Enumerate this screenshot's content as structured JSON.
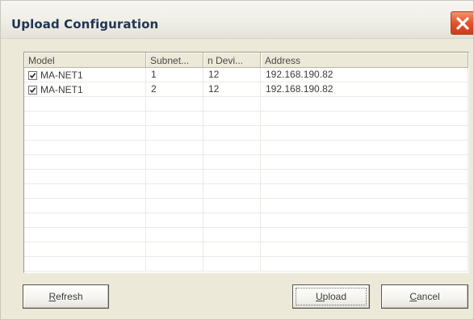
{
  "dialog": {
    "title": "Upload Configuration",
    "close_icon": "close-x-icon"
  },
  "list": {
    "columns": [
      "Model",
      "Subnet...",
      "n Devi...",
      "Address"
    ],
    "rows": [
      {
        "checked": true,
        "model": "MA-NET1",
        "subnet": "1",
        "devices": "12",
        "address": "192.168.190.82"
      },
      {
        "checked": true,
        "model": "MA-NET1",
        "subnet": "2",
        "devices": "12",
        "address": "192.168.190.82"
      }
    ]
  },
  "buttons": {
    "refresh": {
      "mnemonic": "R",
      "rest": "efresh"
    },
    "upload": {
      "mnemonic": "U",
      "rest": "pload"
    },
    "cancel": {
      "mnemonic": "C",
      "rest": "ancel"
    }
  },
  "colors": {
    "dialog_bg": "#ece9d8",
    "title_text": "#1f3554",
    "close_button": "#e2542c"
  }
}
